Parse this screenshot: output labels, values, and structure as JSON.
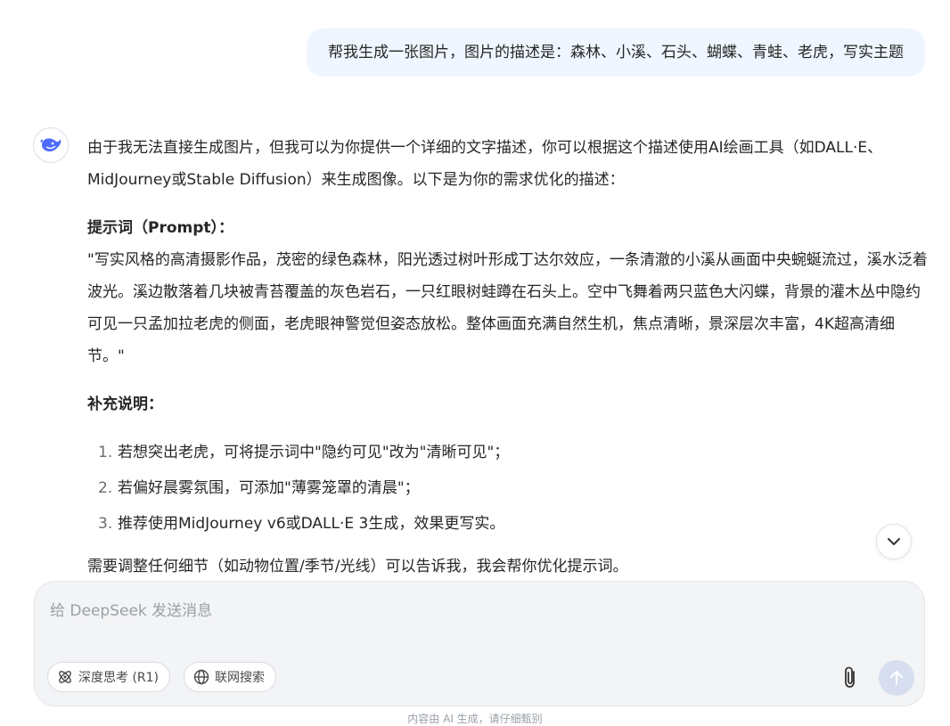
{
  "user_message": "帮我生成一张图片，图片的描述是：森林、小溪、石头、蝴蝶、青蛙、老虎，写实主题",
  "assistant": {
    "intro": "由于我无法直接生成图片，但我可以为你提供一个详细的文字描述，你可以根据这个描述使用AI绘画工具（如DALL·E、MidJourney或Stable Diffusion）来生成图像。以下是为你的需求优化的描述：",
    "prompt_heading": "提示词（Prompt）：",
    "prompt_text": "\"写实风格的高清摄影作品，茂密的绿色森林，阳光透过树叶形成丁达尔效应，一条清澈的小溪从画面中央蜿蜒流过，溪水泛着波光。溪边散落着几块被青苔覆盖的灰色岩石，一只红眼树蛙蹲在石头上。空中飞舞着两只蓝色大闪蝶，背景的灌木丛中隐约可见一只孟加拉老虎的侧面，老虎眼神警觉但姿态放松。整体画面充满自然生机，焦点清晰，景深层次丰富，4K超高清细节。\"",
    "supp_heading": "补充说明：",
    "supp_items": [
      {
        "num": "1.",
        "text": "若想突出老虎，可将提示词中\"隐约可见\"改为\"清晰可见\"；"
      },
      {
        "num": "2.",
        "text": "若偏好晨雾氛围，可添加\"薄雾笼罩的清晨\"；"
      },
      {
        "num": "3.",
        "text": "推荐使用MidJourney v6或DALL·E 3生成，效果更写实。"
      }
    ],
    "outro": "需要调整任何细节（如动物位置/季节/光线）可以告诉我，我会帮你优化提示词。"
  },
  "composer": {
    "placeholder": "给 DeepSeek 发送消息",
    "deep_think_label": "深度思考 (R1)",
    "web_search_label": "联网搜索"
  },
  "footer": "内容由 AI 生成，请仔细甄别",
  "colors": {
    "accent": "#4d6bfe",
    "user_bubble_bg": "#eff6ff",
    "send_disabled": "#d6def0"
  }
}
